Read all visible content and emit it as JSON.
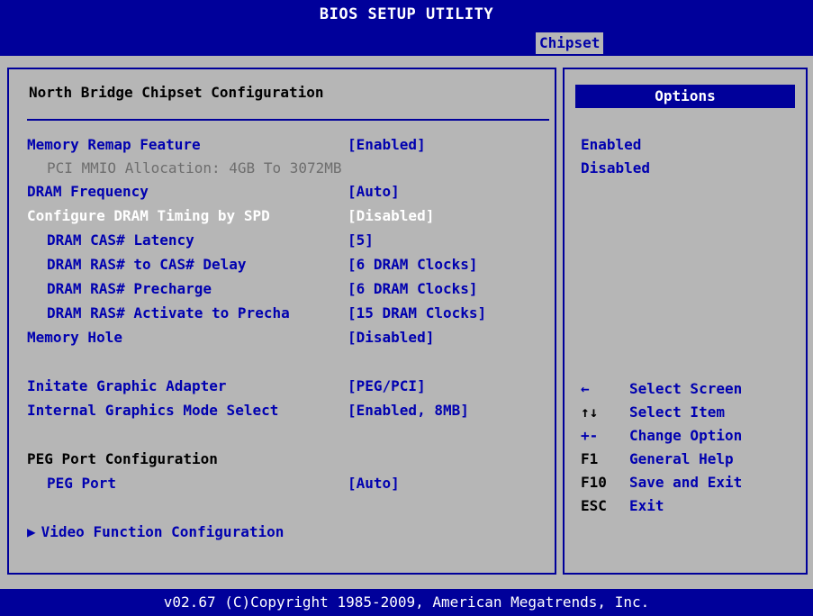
{
  "title": "BIOS SETUP UTILITY",
  "tabs": {
    "active": "Chipset"
  },
  "main": {
    "section_title": "North Bridge Chipset Configuration",
    "items": [
      {
        "label": "Memory Remap Feature",
        "value": "[Enabled]"
      },
      {
        "label": "PCI MMIO Allocation: 4GB To 3072MB",
        "value": ""
      },
      {
        "label": "DRAM Frequency",
        "value": "[Auto]"
      },
      {
        "label": "Configure DRAM Timing by SPD",
        "value": "[Disabled]"
      },
      {
        "label": "DRAM CAS# Latency",
        "value": "[5]"
      },
      {
        "label": "DRAM RAS# to CAS# Delay",
        "value": "[6 DRAM Clocks]"
      },
      {
        "label": "DRAM RAS# Precharge",
        "value": "[6 DRAM Clocks]"
      },
      {
        "label": "DRAM RAS# Activate to Precha",
        "value": "[15 DRAM Clocks]"
      },
      {
        "label": "Memory Hole",
        "value": "[Disabled]"
      },
      {
        "label": "Initate Graphic Adapter",
        "value": "[PEG/PCI]"
      },
      {
        "label": "Internal Graphics Mode Select",
        "value": "[Enabled, 8MB]"
      },
      {
        "label": "PEG Port Configuration",
        "value": ""
      },
      {
        "label": "PEG Port",
        "value": "[Auto]"
      },
      {
        "label": "Video Function Configuration",
        "value": ""
      }
    ],
    "submenu_marker": "▶"
  },
  "options": {
    "header": "Options",
    "items": [
      "Enabled",
      "Disabled"
    ]
  },
  "help": [
    {
      "key": "←",
      "text": "Select Screen"
    },
    {
      "key": "↑↓",
      "text": "Select Item"
    },
    {
      "key": "+-",
      "text": "Change Option"
    },
    {
      "key": "F1",
      "text": "General Help"
    },
    {
      "key": "F10",
      "text": "Save and Exit"
    },
    {
      "key": "ESC",
      "text": "Exit"
    }
  ],
  "footer": "v02.67 (C)Copyright 1985-2009, American Megatrends, Inc.",
  "colors": {
    "background": "#b6b6b6",
    "bar_blue": "#00009a",
    "item_blue": "#0000b0",
    "highlight": "#ffffff",
    "disabled_gray": "#6e6e6e"
  }
}
